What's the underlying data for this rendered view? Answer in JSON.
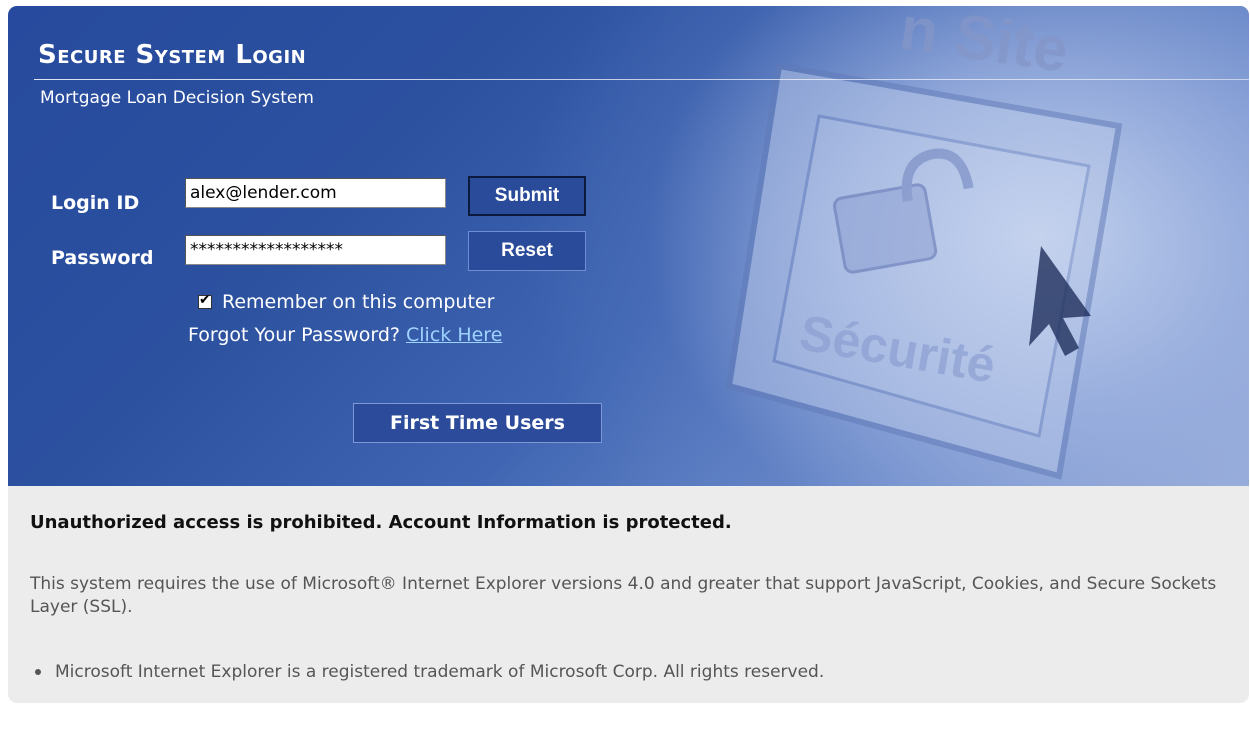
{
  "header": {
    "title": "Secure System Login",
    "subtitle": "Mortgage Loan Decision System",
    "image_text_top": "n Site",
    "image_text_main": "Sécurité"
  },
  "form": {
    "login_label": "Login ID",
    "login_value": "alex@lender.com",
    "password_label": "Password",
    "password_value": "******************",
    "submit_label": "Submit",
    "reset_label": "Reset",
    "remember_label": "Remember on this computer",
    "remember_checked": true,
    "forgot_text": "Forgot Your Password?",
    "forgot_link": "Click Here",
    "first_time_label": "First Time Users"
  },
  "footer": {
    "notice": "Unauthorized access is prohibited. Account Information is protected.",
    "requirements": "This system requires the use of Microsoft® Internet Explorer versions 4.0 and greater that support JavaScript, Cookies, and Secure Sockets Layer (SSL).",
    "trademark": "Microsoft Internet Explorer is a registered trademark of Microsoft Corp. All rights reserved."
  },
  "colors": {
    "banner_dark": "#274a9e",
    "banner_light": "#a9bbe0",
    "button_bg": "#2a4a9a",
    "link": "#9fd3ff",
    "panel_bg": "#ececec"
  }
}
